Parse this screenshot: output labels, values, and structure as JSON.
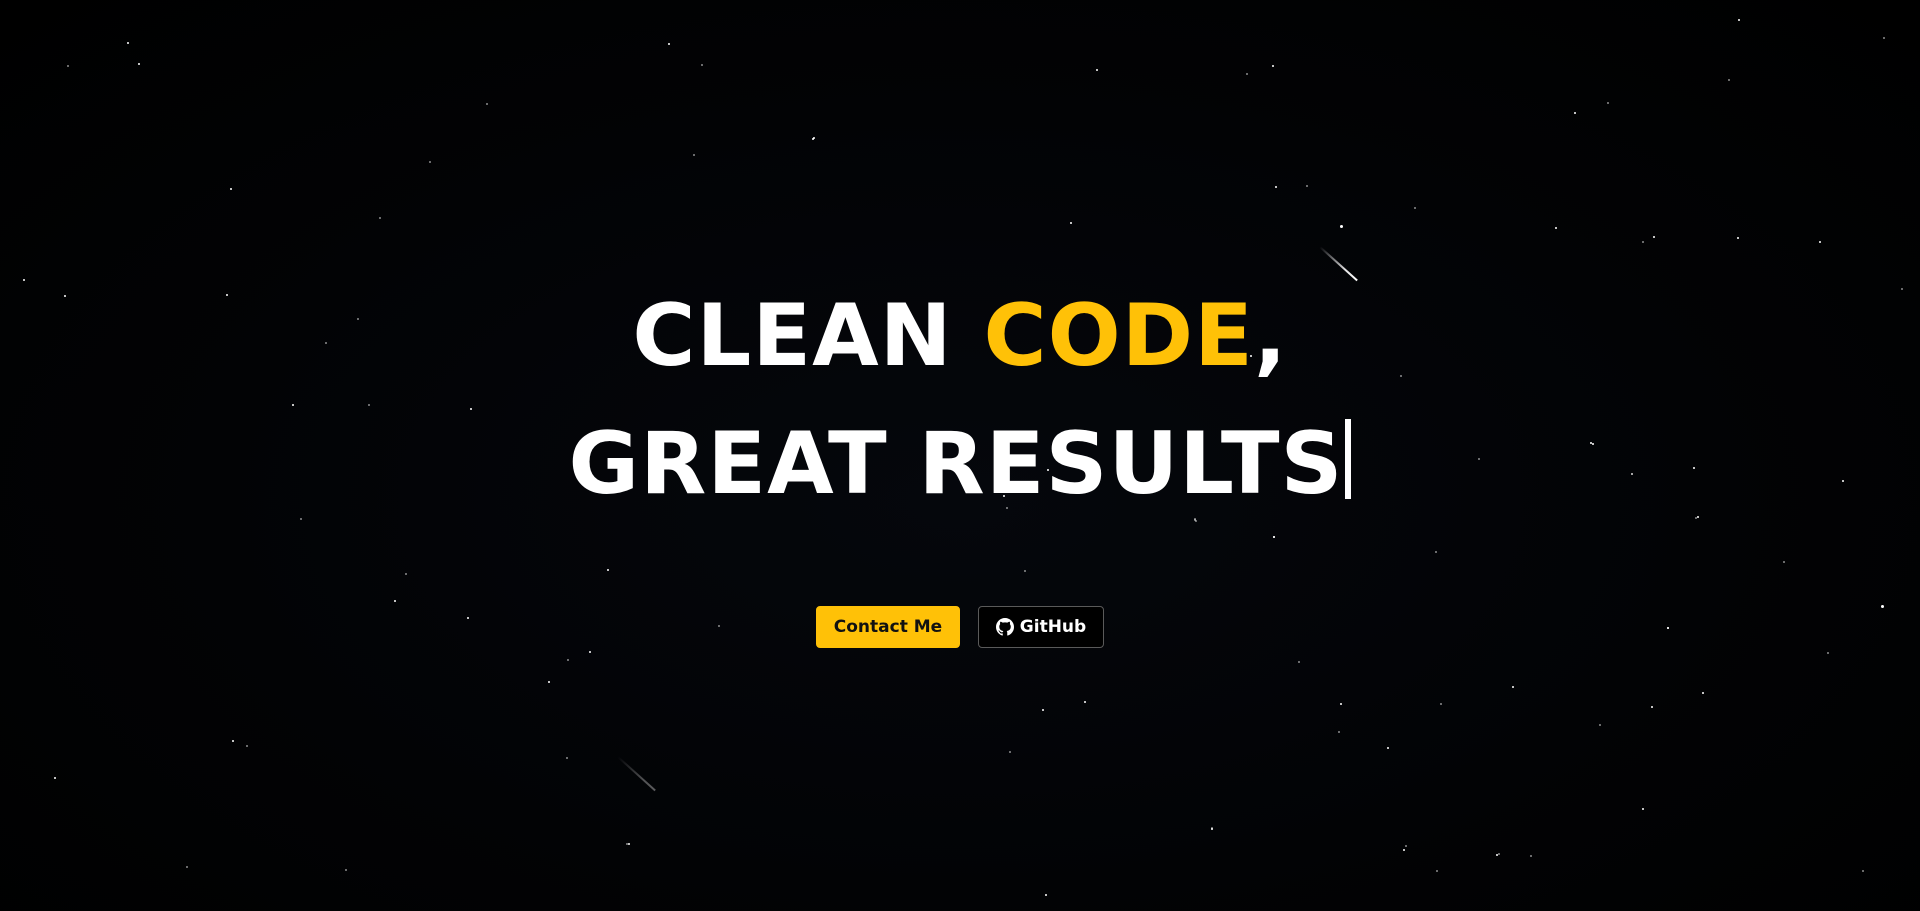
{
  "hero": {
    "headline_line1_prefix": "CLEAN ",
    "headline_line1_accent": "CODE",
    "headline_line1_suffix": ",",
    "headline_line2": "GREAT RESULTS"
  },
  "actions": {
    "contact_label": "Contact Me",
    "github_label": "GitHub"
  },
  "icons": {
    "github": "github-icon"
  },
  "colors": {
    "background": "#000000",
    "accent": "#ffc107",
    "text": "#ffffff"
  }
}
